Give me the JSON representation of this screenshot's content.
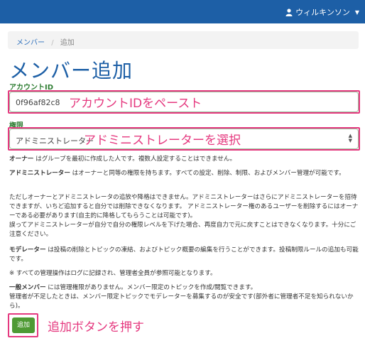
{
  "header": {
    "user_name": "ウィルキンソン"
  },
  "breadcrumb": {
    "members": "メンバー",
    "separator": "/",
    "current": "追加"
  },
  "page": {
    "title": "メンバー追加"
  },
  "form": {
    "account_id_label": "アカウントID",
    "account_id_value": "0f96af82c8",
    "role_label": "権限",
    "role_value": "アドミニストレーター"
  },
  "annotations": {
    "paste_id": "アカウントIDをペースト",
    "select_admin": "アドミニストレーターを選択",
    "press_add": "追加ボタンを押す"
  },
  "descriptions": {
    "owner_term": "オーナー",
    "owner_text": " はグループを最初に作成した人です。複数人設定することはできません。",
    "admin_term": "アドミニストレーター",
    "admin_text": " はオーナーと同等の権限を持ちます。すべての設定、削除、制限、およびメンバー管理が可能です。",
    "admin_note": "ただしオーナーとアドミニストレータの追放や降格はできません。アドミニストレーターはさらにアドミニストレーターを招待できますが、いちど追加すると自分では削除できなくなります。 アドミニストレーター権のあるユーザーを削除するにはオーナーである必要があります(自主的に降格してもらうことは可能です)。\n誤ってアドミニストレーターが自分で自分の権限レベルを下げた場合、再度自力で元に戻すことはできなくなります。十分にご注意ください。",
    "moderator_term": "モデレーター",
    "moderator_text": " は投稿の削除とトピックの凍結、およびトピック概要の編集を行うことができます。投稿制限ルールの追加も可能です。",
    "log_note": "※ すべての管理操作はログに記録され、管理者全員が参照可能となります。",
    "general_term": "一般メンバー",
    "general_text": " には管理権限がありません。メンバー限定のトピックを作成/閲覧できます。\n管理者が不足したときは、メンバー限定トピックでモデレーターを募集するのが安全です(部外者に管理者不足を知られないから)。"
  },
  "buttons": {
    "add_label": "追加"
  },
  "colors": {
    "header_bg": "#1d5fa6",
    "accent_green": "#2e7d32",
    "button_green": "#4e9a34",
    "annotation_pink": "#e5397f"
  }
}
